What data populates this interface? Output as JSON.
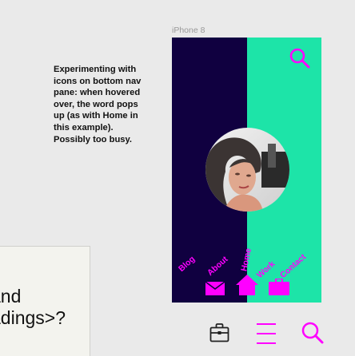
{
  "annotation": {
    "text": "Experimenting with icons on bottom nav pane: when hovered over, the word pops up (as with Home in this example). Possibly too busy."
  },
  "partial_card": {
    "line1": "and",
    "line2": "adings>?"
  },
  "artboard": {
    "label": "iPhone 8"
  },
  "phone": {
    "colors": {
      "left_panel": "#100040",
      "right_panel": "#1de4a8",
      "accent": "#ff00ff"
    },
    "top_icon": "search-icon",
    "nav": [
      {
        "label": "Blog",
        "icon": ""
      },
      {
        "label": "About",
        "icon": "envelope-icon"
      },
      {
        "label": "Home",
        "icon": "home-icon"
      },
      {
        "label": "Work",
        "icon": "briefcase-icon"
      },
      {
        "label": "Contact",
        "icon": ""
      }
    ]
  },
  "bottom_toolbar": {
    "icons": [
      "briefcase-icon",
      "menu-icon",
      "search-icon"
    ],
    "colors": {
      "briefcase": "#222222",
      "accent": "#ff00ff"
    }
  }
}
